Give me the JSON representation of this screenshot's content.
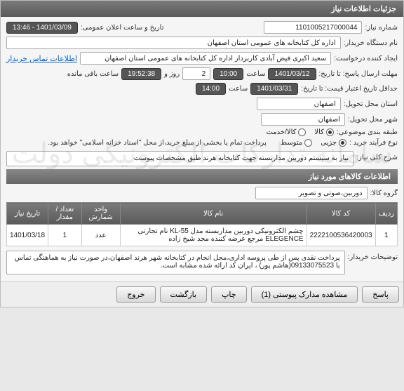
{
  "header": {
    "title": "جزئیات اطلاعات نیاز"
  },
  "fields": {
    "need_no_label": "شماره نیاز:",
    "need_no": "1101005217000044",
    "announce_label": "تاریخ و ساعت اعلان عمومی:",
    "announce_val": "1401/03/09 - 13:46",
    "buyer_label": "نام دستگاه خریدار:",
    "buyer_val": "اداره کل کتابخانه های عمومی استان اصفهان",
    "requester_label": "ایجاد کننده درخواست:",
    "requester_val": "سعید اکبری فیض آبادی کاربردار اداره کل کتابخانه های عمومی استان اصفهان",
    "contact_link": "اطلاعات تماس خریدار",
    "deadline_label": "مهلت ارسال پاسخ: تا تاریخ:",
    "deadline_date": "1401/03/12",
    "time_label": "ساعت",
    "deadline_time": "10:00",
    "days_val": "2",
    "days_label": "روز و",
    "remain_time": "19:52:38",
    "remain_label": "ساعت باقی مانده",
    "validity_label": "حداقل تاریخ اعتبار قیمت: تا تاریخ:",
    "validity_date": "1401/03/31",
    "validity_time": "14:00",
    "province_label": "استان محل تحویل:",
    "province_val": "اصفهان",
    "city_label": "شهر محل تحویل:",
    "city_val": "اصفهان",
    "class_label": "طبقه بندی موضوعی:",
    "radio_goods": "کالا",
    "radio_service": "کالا/خدمت",
    "buy_type_label": "نوع فرآیند خرید :",
    "radio_partial": "جزیی",
    "radio_medium": "متوسط",
    "buy_note": "پرداخت تمام یا بخشی از مبلغ خرید،از محل \"اسناد خزانه اسلامی\" خواهد بود.",
    "desc_label": "شرح کلی نیاز:",
    "desc_val": "نیاز به سیستم دوربین مداربسته جهت کتابخانه هرند طبق مشخصات پیوست",
    "items_title": "اطلاعات کالاهای مورد نیاز",
    "group_label": "گروه کالا:",
    "group_val": "دوربین،صوتی و تصویر",
    "notes_label": "توضیحات خریدار:",
    "notes_val": "پرداخت نقدی پس از طی پروسه اداری،محل انجام در کتابخانه شهر هرند اصفهان،در صورت نیاز به هماهنگی تماس با 09133075523(هاشم پور) ، ایران کد ارائه شده مشابه است."
  },
  "table": {
    "headers": {
      "row": "ردیف",
      "code": "کد کالا",
      "name": "نام کالا",
      "unit": "واحد شمارش",
      "qty": "تعداد / مقدار",
      "date": "تاریخ نیاز"
    },
    "rows": [
      {
        "row": "1",
        "code": "2222100536420003",
        "name": "چشم الکترونیکی دوربین مداربسته مدل KL-55 نام تجارتی ELEGENCE مرجع عرضه کننده مجد شیخ زاده",
        "unit": "عدد",
        "qty": "1",
        "date": "1401/03/18"
      }
    ]
  },
  "buttons": {
    "answer": "پاسخ",
    "attachments": "مشاهده مدارک پیوستی  (1)",
    "print": "چاپ",
    "back": "بازگشت",
    "exit": "خروج"
  },
  "watermark": "سامانه تدارکات الکترونیکی دولت"
}
